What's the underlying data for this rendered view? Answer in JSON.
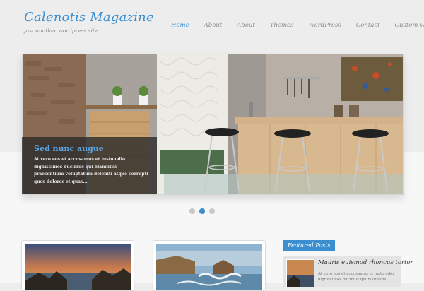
{
  "site": {
    "title": "Calenotis Magazine",
    "tagline": "just another wordpress site"
  },
  "nav": {
    "items": [
      "Home",
      "About",
      "About",
      "Themes",
      "WordPress",
      "Contact",
      "Custom work"
    ],
    "active": "Home"
  },
  "slider": {
    "caption_title": "Sed nunc augue",
    "caption_text": "At vero eos et accusamus et iusto odio dignissimos ducimus qui blanditiis praesentium voluptatum deleniti atque corrupti quos dolores et quas...",
    "total_slides": 3,
    "active_slide": 2
  },
  "featured": {
    "label": "Featured Posts",
    "post_title": "Mauris euismod rhoncus tortor",
    "post_excerpt": "At vero eos et accusamus et iusto odio dignissimos ducimus qui blanditiis"
  },
  "colors": {
    "accent": "#3b8fd0",
    "nav_text": "#8c8c8c"
  }
}
